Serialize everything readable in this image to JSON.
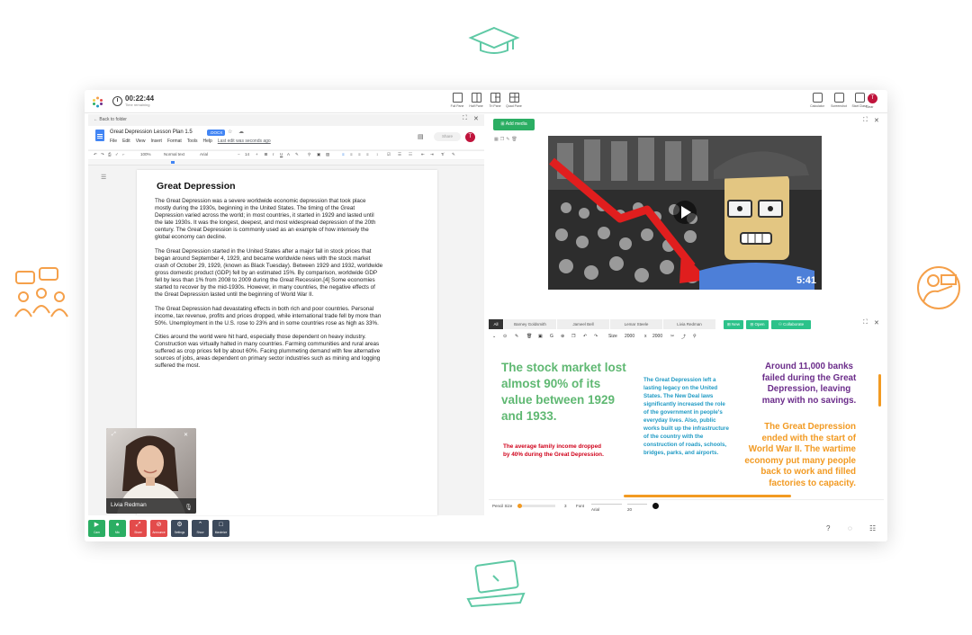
{
  "colors": {
    "accent_green": "#2bae63",
    "accent_orange": "#f29a22",
    "purple": "#6b2c8a",
    "teal": "#1f9ac4",
    "red": "#d0021b",
    "deco_green": "#5fc9a5",
    "deco_orange": "#f5a04a",
    "avatar": "#c0143c"
  },
  "topbar": {
    "timer_value": "00:22:44",
    "timer_label": "Time remaining",
    "layouts": [
      "Full Pane",
      "Half Pane",
      "Tri Pane",
      "Quad Pane"
    ],
    "tools": [
      "Calculator",
      "Screenshot",
      "Start Class",
      "Clear"
    ],
    "user_initial": "T"
  },
  "doc": {
    "back_label": "Back to folder",
    "title": "Great Depression Lesson Plan 1.5",
    "badge": ".DOCX",
    "menu": [
      "File",
      "Edit",
      "View",
      "Insert",
      "Format",
      "Tools",
      "Help"
    ],
    "last_edit": "Last edit was seconds ago",
    "share_label": "Share",
    "avatar_initial": "T",
    "toolbar": {
      "zoom": "100%",
      "style": "Normal text",
      "font": "Arial",
      "size": "14"
    },
    "heading": "Great Depression",
    "paragraphs": [
      "The Great Depression was a severe worldwide economic depression that took place mostly during the 1930s, beginning in the United States. The timing of the Great Depression varied across the world; in most countries, it started in 1929 and lasted until the late 1930s. It was the longest, deepest, and most widespread depression of the 20th century. The Great Depression is commonly used as an example of how intensely the global economy can decline.",
      "The Great Depression started in the United States after a major fall in stock prices that began around September 4, 1929, and became worldwide news with the stock market crash of October 29, 1929, (known as Black Tuesday). Between 1929 and 1932, worldwide gross domestic product (GDP) fell by an estimated 15%. By comparison, worldwide GDP fell by less than 1% from 2008 to 2009 during the Great Recession.[4] Some economies started to recover by the mid-1930s. However, in many countries, the negative effects of the Great Depression lasted until the beginning of World War II.",
      "The Great Depression had devastating effects in both rich and poor countries. Personal income, tax revenue, profits and prices dropped, while international trade fell by more than 50%. Unemployment in the U.S. rose to 23% and in some countries rose as high as 33%.",
      "Cities around the world were hit hard, especially those dependent on heavy industry. Construction was virtually halted in many countries. Farming communities and rural areas suffered as crop prices fell by about 60%. Facing plummeting demand with few alternative sources of jobs, areas dependent on primary sector industries such as mining and logging suffered the most."
    ]
  },
  "video_tile": {
    "name": "Livia Redman"
  },
  "media": {
    "add_label": "Add media",
    "duration": "5:41"
  },
  "whiteboard": {
    "tabs": [
      "All",
      "Barney Goldsmith",
      "Jameel Bell",
      "Lemar Steele",
      "Livia Redman"
    ],
    "actions": [
      "New",
      "Open",
      "Collaborate"
    ],
    "size_label": "Size",
    "width": "2000",
    "by": "x",
    "height": "2000",
    "texts": {
      "green": "The stock market lost almost 90% of its value between 1929 and 1933.",
      "red": "The average family income dropped by 40% during the Great Depression.",
      "teal": "The Great Depression left a lasting legacy on the United States. The New Deal laws significantly increased the role of the government in people's everyday lives. Also, public works built up the infrastructure of the country with the construction of roads, schools, bridges, parks, and airports.",
      "purple": "Around 11,000 banks failed during the Great Depression, leaving many with no savings.",
      "orange": "The Great Depression ended with the start of World War II. The wartime economy put many people back to work and filled factories to capacity."
    },
    "pencil_label": "Pencil Size",
    "pencil_value": "3",
    "font_label": "Font",
    "font_value": "Arial",
    "font_size": "20"
  },
  "bottombar": {
    "buttons": [
      {
        "label": "Cam",
        "color": "#2bae63",
        "icon": "video-icon"
      },
      {
        "label": "Mic",
        "color": "#2bae63",
        "icon": "mic-icon"
      },
      {
        "label": "Share",
        "color": "#e34b4b",
        "icon": "share-screen-icon"
      },
      {
        "label": "Announce",
        "color": "#e34b4b",
        "icon": "announce-icon"
      },
      {
        "label": "Settings",
        "color": "#3d4a5c",
        "icon": "gear-icon"
      },
      {
        "label": "Show",
        "color": "#3d4a5c",
        "icon": "chevron-up-icon"
      },
      {
        "label": "Maximize",
        "color": "#3d4a5c",
        "icon": "maximize-icon"
      }
    ]
  }
}
